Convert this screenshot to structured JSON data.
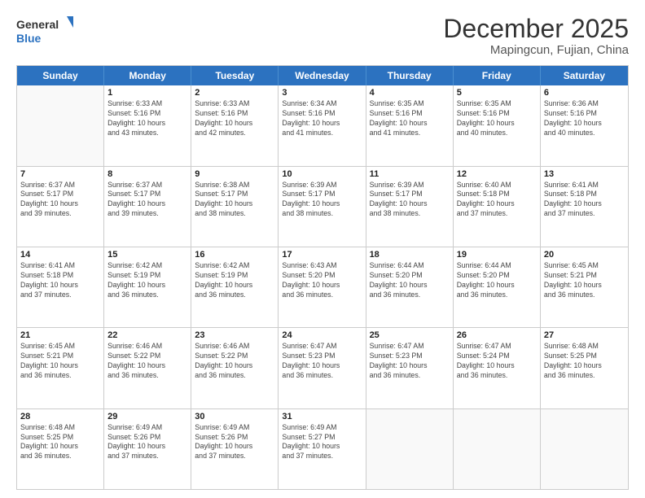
{
  "logo": {
    "line1": "General",
    "line2": "Blue"
  },
  "title": "December 2025",
  "subtitle": "Mapingcun, Fujian, China",
  "weekdays": [
    "Sunday",
    "Monday",
    "Tuesday",
    "Wednesday",
    "Thursday",
    "Friday",
    "Saturday"
  ],
  "weeks": [
    [
      {
        "day": "",
        "info": ""
      },
      {
        "day": "1",
        "info": "Sunrise: 6:33 AM\nSunset: 5:16 PM\nDaylight: 10 hours\nand 43 minutes."
      },
      {
        "day": "2",
        "info": "Sunrise: 6:33 AM\nSunset: 5:16 PM\nDaylight: 10 hours\nand 42 minutes."
      },
      {
        "day": "3",
        "info": "Sunrise: 6:34 AM\nSunset: 5:16 PM\nDaylight: 10 hours\nand 41 minutes."
      },
      {
        "day": "4",
        "info": "Sunrise: 6:35 AM\nSunset: 5:16 PM\nDaylight: 10 hours\nand 41 minutes."
      },
      {
        "day": "5",
        "info": "Sunrise: 6:35 AM\nSunset: 5:16 PM\nDaylight: 10 hours\nand 40 minutes."
      },
      {
        "day": "6",
        "info": "Sunrise: 6:36 AM\nSunset: 5:16 PM\nDaylight: 10 hours\nand 40 minutes."
      }
    ],
    [
      {
        "day": "7",
        "info": "Sunrise: 6:37 AM\nSunset: 5:17 PM\nDaylight: 10 hours\nand 39 minutes."
      },
      {
        "day": "8",
        "info": "Sunrise: 6:37 AM\nSunset: 5:17 PM\nDaylight: 10 hours\nand 39 minutes."
      },
      {
        "day": "9",
        "info": "Sunrise: 6:38 AM\nSunset: 5:17 PM\nDaylight: 10 hours\nand 38 minutes."
      },
      {
        "day": "10",
        "info": "Sunrise: 6:39 AM\nSunset: 5:17 PM\nDaylight: 10 hours\nand 38 minutes."
      },
      {
        "day": "11",
        "info": "Sunrise: 6:39 AM\nSunset: 5:17 PM\nDaylight: 10 hours\nand 38 minutes."
      },
      {
        "day": "12",
        "info": "Sunrise: 6:40 AM\nSunset: 5:18 PM\nDaylight: 10 hours\nand 37 minutes."
      },
      {
        "day": "13",
        "info": "Sunrise: 6:41 AM\nSunset: 5:18 PM\nDaylight: 10 hours\nand 37 minutes."
      }
    ],
    [
      {
        "day": "14",
        "info": "Sunrise: 6:41 AM\nSunset: 5:18 PM\nDaylight: 10 hours\nand 37 minutes."
      },
      {
        "day": "15",
        "info": "Sunrise: 6:42 AM\nSunset: 5:19 PM\nDaylight: 10 hours\nand 36 minutes."
      },
      {
        "day": "16",
        "info": "Sunrise: 6:42 AM\nSunset: 5:19 PM\nDaylight: 10 hours\nand 36 minutes."
      },
      {
        "day": "17",
        "info": "Sunrise: 6:43 AM\nSunset: 5:20 PM\nDaylight: 10 hours\nand 36 minutes."
      },
      {
        "day": "18",
        "info": "Sunrise: 6:44 AM\nSunset: 5:20 PM\nDaylight: 10 hours\nand 36 minutes."
      },
      {
        "day": "19",
        "info": "Sunrise: 6:44 AM\nSunset: 5:20 PM\nDaylight: 10 hours\nand 36 minutes."
      },
      {
        "day": "20",
        "info": "Sunrise: 6:45 AM\nSunset: 5:21 PM\nDaylight: 10 hours\nand 36 minutes."
      }
    ],
    [
      {
        "day": "21",
        "info": "Sunrise: 6:45 AM\nSunset: 5:21 PM\nDaylight: 10 hours\nand 36 minutes."
      },
      {
        "day": "22",
        "info": "Sunrise: 6:46 AM\nSunset: 5:22 PM\nDaylight: 10 hours\nand 36 minutes."
      },
      {
        "day": "23",
        "info": "Sunrise: 6:46 AM\nSunset: 5:22 PM\nDaylight: 10 hours\nand 36 minutes."
      },
      {
        "day": "24",
        "info": "Sunrise: 6:47 AM\nSunset: 5:23 PM\nDaylight: 10 hours\nand 36 minutes."
      },
      {
        "day": "25",
        "info": "Sunrise: 6:47 AM\nSunset: 5:23 PM\nDaylight: 10 hours\nand 36 minutes."
      },
      {
        "day": "26",
        "info": "Sunrise: 6:47 AM\nSunset: 5:24 PM\nDaylight: 10 hours\nand 36 minutes."
      },
      {
        "day": "27",
        "info": "Sunrise: 6:48 AM\nSunset: 5:25 PM\nDaylight: 10 hours\nand 36 minutes."
      }
    ],
    [
      {
        "day": "28",
        "info": "Sunrise: 6:48 AM\nSunset: 5:25 PM\nDaylight: 10 hours\nand 36 minutes."
      },
      {
        "day": "29",
        "info": "Sunrise: 6:49 AM\nSunset: 5:26 PM\nDaylight: 10 hours\nand 37 minutes."
      },
      {
        "day": "30",
        "info": "Sunrise: 6:49 AM\nSunset: 5:26 PM\nDaylight: 10 hours\nand 37 minutes."
      },
      {
        "day": "31",
        "info": "Sunrise: 6:49 AM\nSunset: 5:27 PM\nDaylight: 10 hours\nand 37 minutes."
      },
      {
        "day": "",
        "info": ""
      },
      {
        "day": "",
        "info": ""
      },
      {
        "day": "",
        "info": ""
      }
    ]
  ]
}
